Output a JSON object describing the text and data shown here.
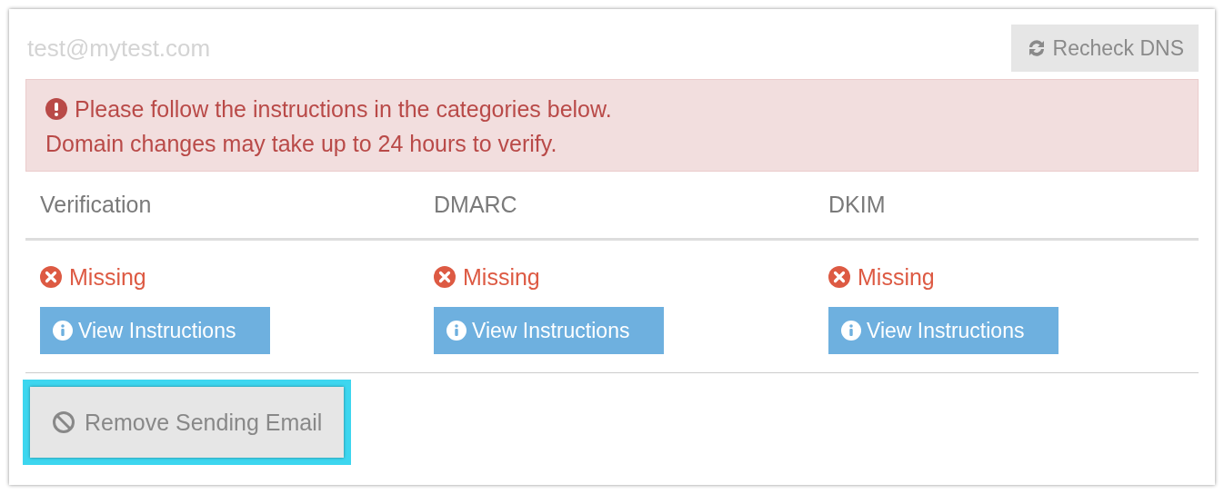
{
  "email": "test@mytest.com",
  "recheck_button": {
    "label": "Recheck DNS"
  },
  "alert": {
    "lines": [
      "Please follow the instructions in the categories below.",
      "Domain changes may take up to 24 hours to verify."
    ]
  },
  "categories": [
    {
      "name": "Verification",
      "status": {
        "kind": "missing",
        "label": "Missing"
      },
      "button": "View Instructions"
    },
    {
      "name": "DMARC",
      "status": {
        "kind": "missing",
        "label": "Missing"
      },
      "button": "View Instructions"
    },
    {
      "name": "DKIM",
      "status": {
        "kind": "missing",
        "label": "Missing"
      },
      "button": "View Instructions"
    }
  ],
  "remove_button": {
    "label": "Remove Sending Email",
    "highlighted": true
  }
}
